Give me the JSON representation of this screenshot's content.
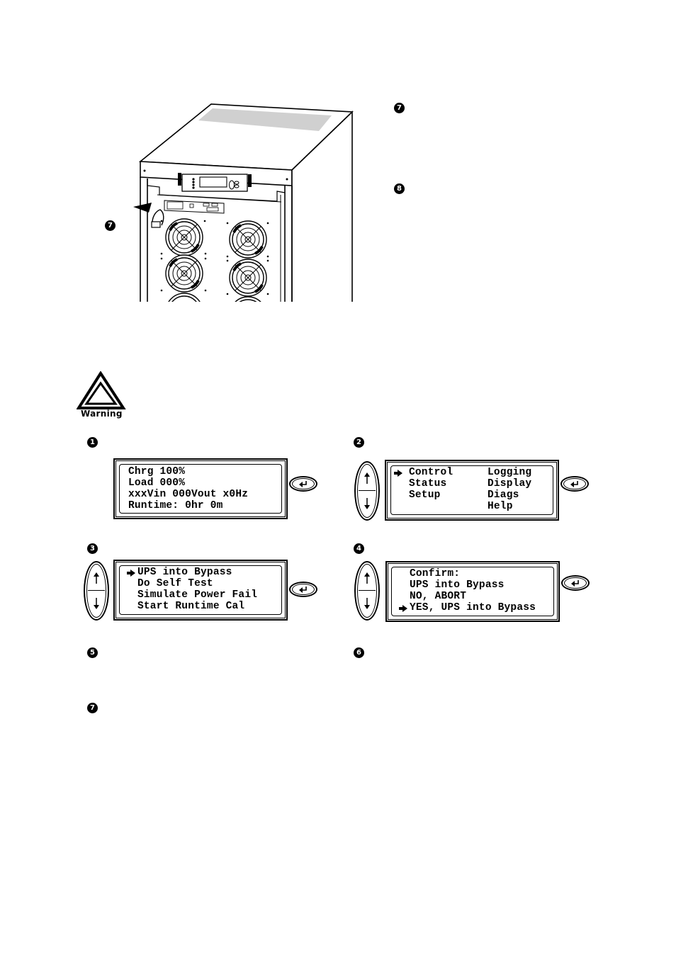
{
  "figure": {
    "callout_on_image": "7",
    "side_steps": [
      "7",
      "8"
    ]
  },
  "warning": {
    "icon": "warning-triangle-icon",
    "label": "Warning"
  },
  "steps": [
    {
      "number": "1",
      "lcd_lines": [
        "Chrg 100%",
        "Load 000%",
        "xxxVin 000Vout x0Hz",
        "Runtime: 0hr 0m"
      ],
      "has_updown": false,
      "has_enter": true
    },
    {
      "number": "2",
      "lcd_columns": [
        [
          "Control",
          "Status",
          "Setup",
          ""
        ],
        [
          "Logging",
          "Display",
          "Diags",
          "Help"
        ]
      ],
      "selected": "Control",
      "has_updown": true,
      "has_enter": true
    },
    {
      "number": "3",
      "lcd_lines": [
        "UPS into Bypass",
        "Do Self Test",
        "Simulate Power Fail",
        "Start Runtime Cal"
      ],
      "selected": "UPS into Bypass",
      "has_updown": true,
      "has_enter": true
    },
    {
      "number": "4",
      "lcd_lines": [
        "Confirm:",
        "UPS into Bypass",
        "NO, ABORT",
        "YES, UPS into Bypass"
      ],
      "selected": "YES, UPS into Bypass",
      "has_updown": true,
      "has_enter": true
    },
    {
      "number": "5"
    },
    {
      "number": "6"
    },
    {
      "number": "7"
    }
  ],
  "icons": {
    "selector": "right-arrow-icon",
    "enter": "enter-key-icon",
    "up": "up-arrow-icon",
    "down": "down-arrow-icon"
  }
}
